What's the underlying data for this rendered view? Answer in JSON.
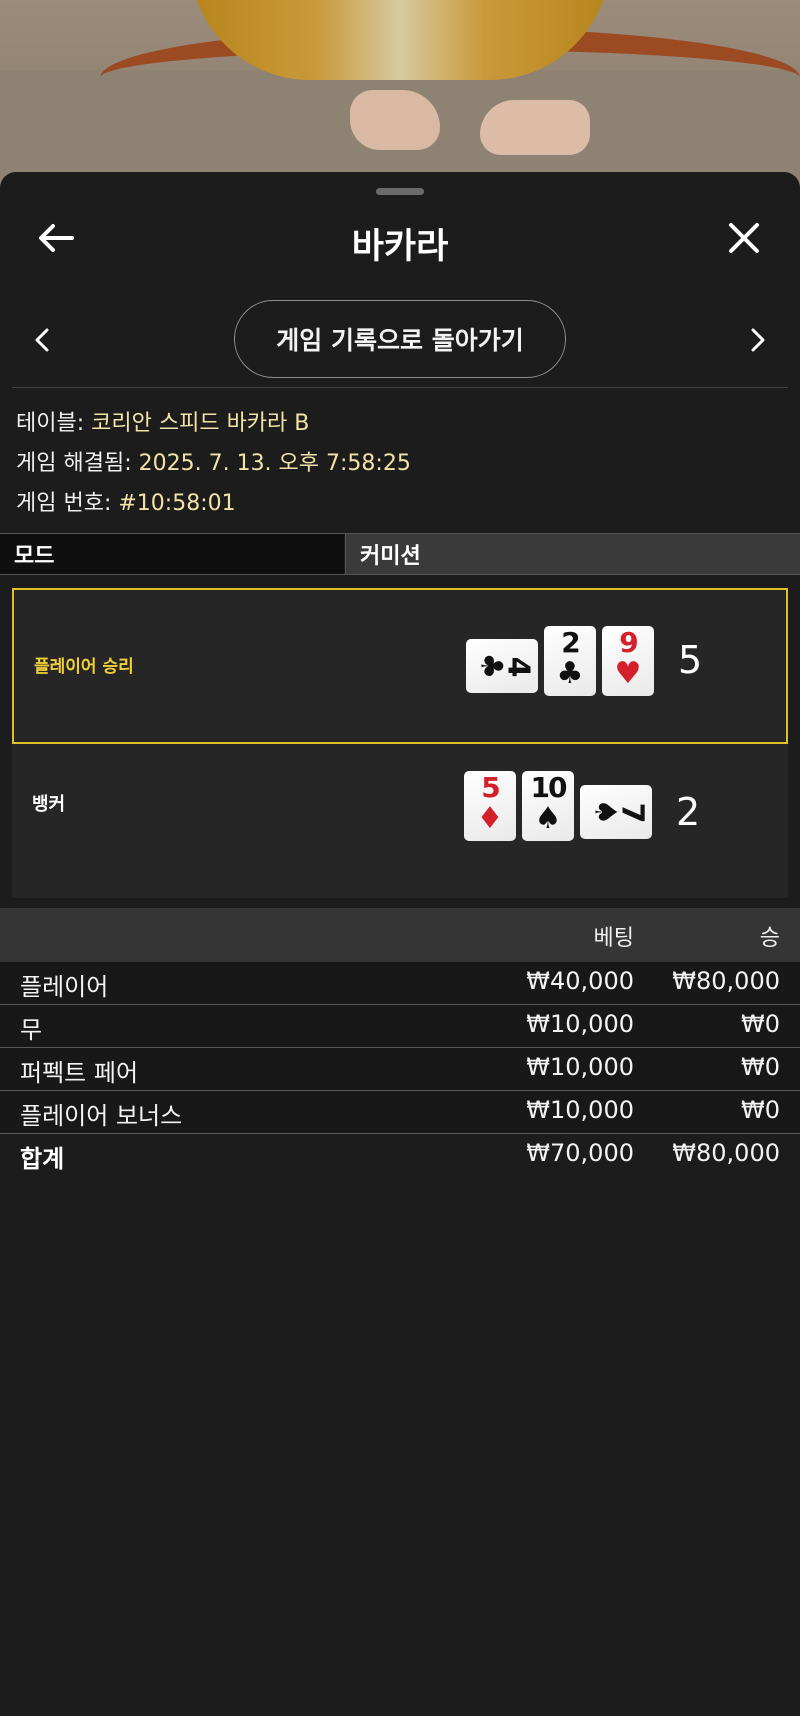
{
  "header": {
    "title": "바카라"
  },
  "nav": {
    "back_to_history": "게임 기록으로 돌아가기"
  },
  "info": {
    "table_label": "테이블:",
    "table_value": "코리안 스피드 바카라 B",
    "resolved_label": "게임 해결됨:",
    "resolved_value": "2025. 7. 13. 오후 7:58:25",
    "game_no_label": "게임 번호:",
    "game_no_value": "#10:58:01"
  },
  "mode": {
    "left": "모드",
    "right": "커미션"
  },
  "hands": {
    "player": {
      "label": "플레이어 승리",
      "score": "5",
      "cards": [
        {
          "rank": "4",
          "suit": "♣",
          "color": "black",
          "orientation": "sideways"
        },
        {
          "rank": "2",
          "suit": "♣",
          "color": "black",
          "orientation": "upright"
        },
        {
          "rank": "9",
          "suit": "♥",
          "color": "red",
          "orientation": "upright"
        }
      ]
    },
    "banker": {
      "label": "뱅커",
      "score": "2",
      "cards": [
        {
          "rank": "5",
          "suit": "♦",
          "color": "red",
          "orientation": "upright"
        },
        {
          "rank": "10",
          "suit": "♠",
          "color": "black",
          "orientation": "upright"
        },
        {
          "rank": "7",
          "suit": "♠",
          "color": "black",
          "orientation": "sideways"
        }
      ]
    }
  },
  "bets": {
    "headers": {
      "bet": "베팅",
      "win": "승"
    },
    "rows": [
      {
        "name": "플레이어",
        "bet": "₩40,000",
        "win": "₩80,000"
      },
      {
        "name": "무",
        "bet": "₩10,000",
        "win": "₩0"
      },
      {
        "name": "퍼펙트 페어",
        "bet": "₩10,000",
        "win": "₩0"
      },
      {
        "name": "플레이어 보너스",
        "bet": "₩10,000",
        "win": "₩0"
      }
    ],
    "total": {
      "name": "합계",
      "bet": "₩70,000",
      "win": "₩80,000"
    }
  },
  "colors": {
    "accent_gold": "#e0c028",
    "value_text": "#f1e3a6",
    "card_red": "#d4202a"
  }
}
